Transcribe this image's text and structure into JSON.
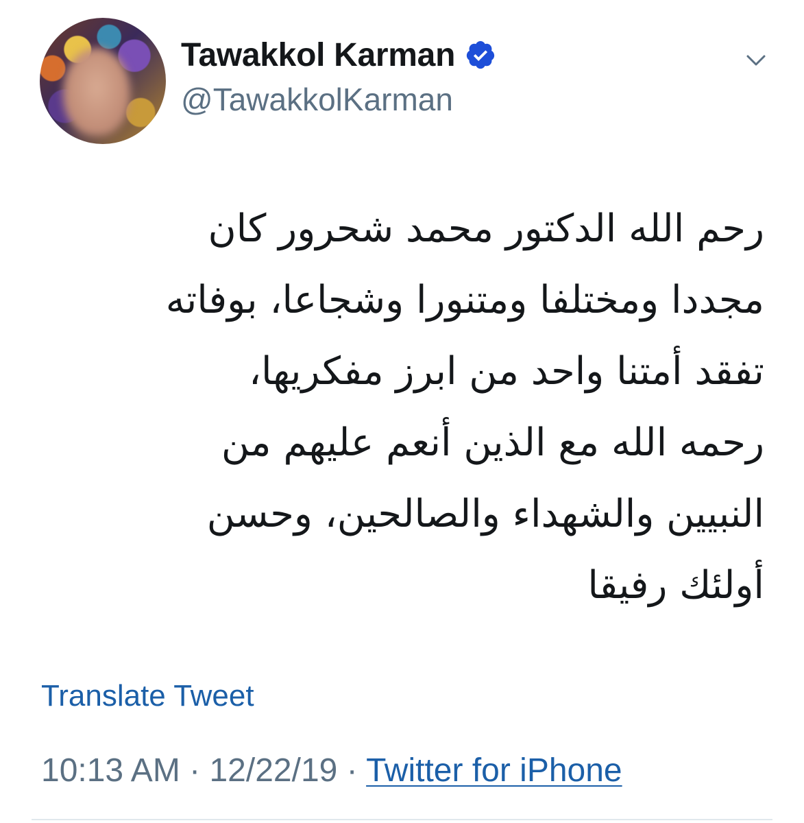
{
  "user": {
    "display_name": "Tawakkol Karman",
    "handle": "@TawakkolKarman",
    "verified_icon": "verified-badge-icon",
    "avatar_icon": "avatar-photo"
  },
  "menu": {
    "chevron_icon": "chevron-down-icon"
  },
  "tweet": {
    "lines": [
      "رحم الله الدكتور محمد شحرور كان",
      "مجددا ومختلفا ومتنورا وشجاعا، بوفاته",
      "تفقد أمتنا واحد من ابرز مفكريها،",
      "رحمه الله مع الذين أنعم عليهم من",
      "النبيين والشهداء والصالحين، وحسن",
      "أولئك رفيقا"
    ]
  },
  "translate_label": "Translate Tweet",
  "meta": {
    "time": "10:13 AM",
    "separator": "·",
    "date": "12/22/19",
    "source": "Twitter for iPhone"
  },
  "colors": {
    "link_blue": "#1b5fa8",
    "verified_blue": "#1d9bf0",
    "secondary_text": "#5b7083",
    "primary_text": "#14171a"
  }
}
